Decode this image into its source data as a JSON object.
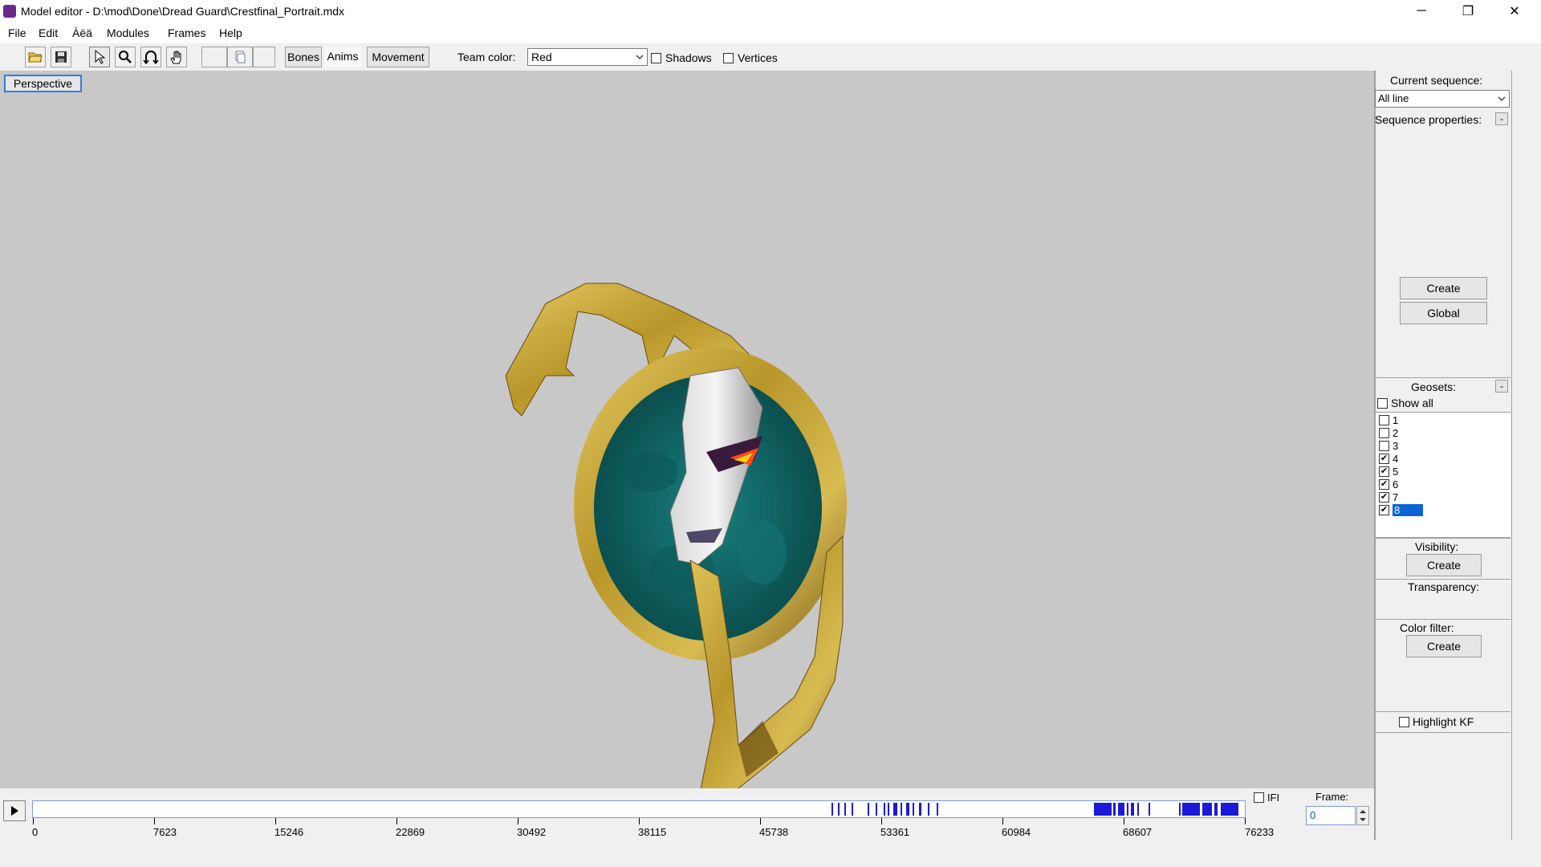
{
  "window": {
    "title": "Model editor - D:\\mod\\Done\\Dread Guard\\Crestfinal_Portrait.mdx",
    "minimize": "─",
    "maximize": "❐",
    "close": "✕"
  },
  "menu": [
    "File",
    "Edit",
    "Àëä",
    "Modules",
    "Frames",
    "Help"
  ],
  "toolbar": {
    "buttons": [
      "open-icon",
      "save-icon",
      "select-cursor-icon",
      "zoom-icon",
      "rotate-icon",
      "pan-hand-icon",
      "copy-icon"
    ],
    "bones": "Bones",
    "anims": "Anims",
    "movement": "Movement",
    "team_color_label": "Team color:",
    "team_color_value": "Red",
    "shadows": "Shadows",
    "vertices": "Vertices"
  },
  "viewport": {
    "mode": "Perspective"
  },
  "panel": {
    "current_sequence_label": "Current sequence:",
    "current_sequence_value": "All line",
    "sequence_properties_label": "Sequence properties:",
    "collapse": "-",
    "create": "Create",
    "global": "Global",
    "geosets_label": "Geosets:",
    "show_all": "Show all",
    "geosets": [
      {
        "label": "1",
        "checked": false
      },
      {
        "label": "2",
        "checked": false
      },
      {
        "label": "3",
        "checked": false
      },
      {
        "label": "4",
        "checked": true
      },
      {
        "label": "5",
        "checked": true
      },
      {
        "label": "6",
        "checked": true
      },
      {
        "label": "7",
        "checked": true
      },
      {
        "label": "8",
        "checked": true,
        "selected": true
      }
    ],
    "visibility_label": "Visibility:",
    "visibility_create": "Create",
    "transparency_label": "Transparency:",
    "color_filter_label": "Color filter:",
    "color_filter_create": "Create",
    "highlight_kf": "Highlight KF"
  },
  "timeline": {
    "ifi": "IFI",
    "frame_label": "Frame:",
    "frame_value": "0",
    "ticks": [
      "0",
      "7623",
      "15246",
      "22869",
      "30492",
      "38115",
      "45738",
      "53361",
      "60984",
      "68607",
      "76233"
    ]
  },
  "colors": {
    "viewport_bg": "#c8c8c8",
    "keyframe": "#1a1ad8",
    "gold": "#c9a93a",
    "teal": "#0f6a6a",
    "selection": "#0a64d8"
  }
}
